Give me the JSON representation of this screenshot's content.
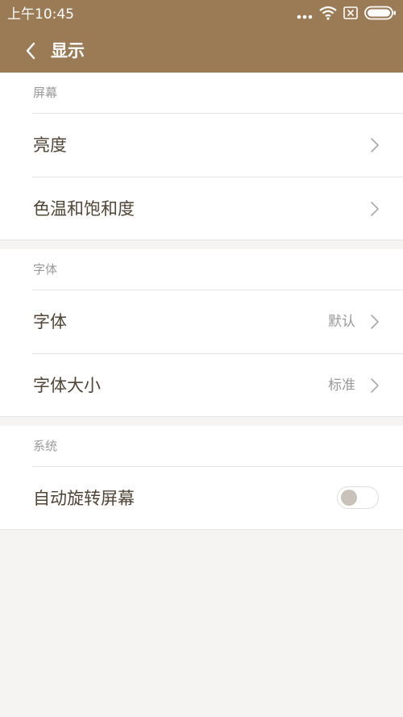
{
  "status_bar": {
    "time": "上午10:45",
    "icons": [
      "more-dots-icon",
      "wifi-icon",
      "sim-none-icon",
      "battery-icon"
    ]
  },
  "header": {
    "title": "显示",
    "back_icon": "back-arrow-icon"
  },
  "sections": [
    {
      "header": "屏幕",
      "items": [
        {
          "label": "亮度",
          "value": "",
          "control": "chevron"
        },
        {
          "label": "色温和饱和度",
          "value": "",
          "control": "chevron"
        }
      ]
    },
    {
      "header": "字体",
      "items": [
        {
          "label": "字体",
          "value": "默认",
          "control": "chevron"
        },
        {
          "label": "字体大小",
          "value": "标准",
          "control": "chevron"
        }
      ]
    },
    {
      "header": "系统",
      "items": [
        {
          "label": "自动旋转屏幕",
          "value": "",
          "control": "toggle",
          "enabled": false
        }
      ]
    }
  ],
  "colors": {
    "accent": "#9b7b55",
    "background": "#f5f4f2",
    "label_text": "#4f4436",
    "secondary_text": "#9a9a9a"
  }
}
